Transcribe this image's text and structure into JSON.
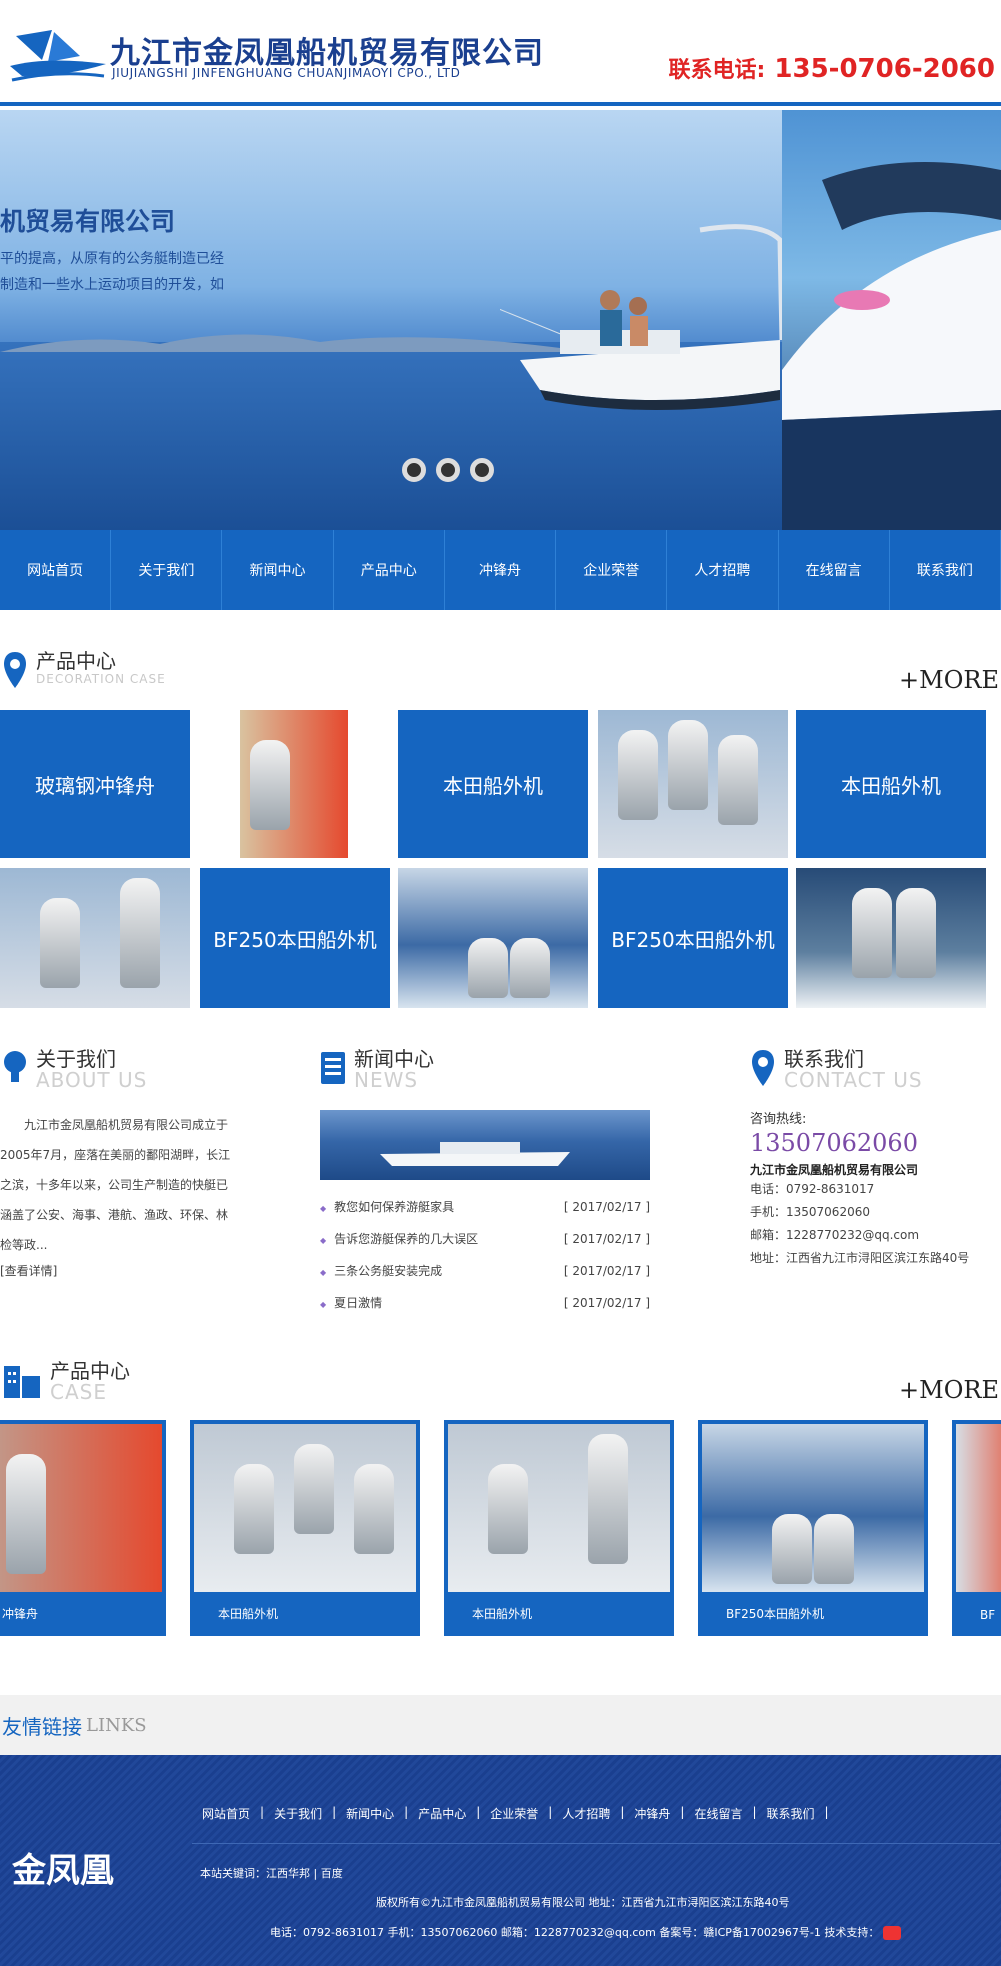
{
  "header": {
    "company_cn": "九江市金凤凰船机贸易有限公司",
    "company_en": "JIUJIANGSHI JINFENGHUANG CHUANJIMAOYI CPO., LTD",
    "phone_label": "联系电话:",
    "phone_number": "135-0706-2060"
  },
  "banner": {
    "title": "机贸易有限公司",
    "line1": "平的提高，从原有的公务艇制造已经",
    "line2": "制造和一些水上运动项目的开发，如"
  },
  "nav": [
    "网站首页",
    "关于我们",
    "新闻中心",
    "产品中心",
    "冲锋舟",
    "企业荣誉",
    "人才招聘",
    "在线留言",
    "联系我们"
  ],
  "products": {
    "title_cn": "产品中心",
    "title_en": "DECORATION  CASE",
    "more": "+MORE",
    "row1_labels": [
      "玻璃钢冲锋舟",
      "本田船外机",
      "本田船外机"
    ],
    "row2_labels": [
      "BF250本田船外机",
      "BF250本田船外机"
    ]
  },
  "about": {
    "title_cn": "关于我们",
    "title_en": "ABOUT US",
    "text": "九江市金凤凰船机贸易有限公司成立于2005年7月，座落在美丽的鄱阳湖畔，长江之滨，十多年以来，公司生产制造的快艇已涵盖了公安、海事、港航、渔政、环保、林检等政...",
    "more": "[查看详情]"
  },
  "news": {
    "title_cn": "新闻中心",
    "title_en": "NEWS",
    "items": [
      {
        "title": "教您如何保养游艇家具",
        "date": "[ 2017/02/17 ]"
      },
      {
        "title": "告诉您游艇保养的几大误区",
        "date": "[ 2017/02/17 ]"
      },
      {
        "title": "三条公务艇安装完成",
        "date": "[ 2017/02/17 ]"
      },
      {
        "title": "夏日激情",
        "date": "[ 2017/02/17 ]"
      }
    ]
  },
  "contact": {
    "title_cn": "联系我们",
    "title_en": "CONTACT US",
    "hotline_label": "咨询热线:",
    "hotline": "13507062060",
    "company": "九江市金凤凰船机贸易有限公司",
    "phone": "电话：0792-8631017",
    "mobile": "手机：13507062060",
    "email": "邮箱：1228770232@qq.com",
    "address": "地址：江西省九江市浔阳区滨江东路40号"
  },
  "cases": {
    "title_cn": "产品中心",
    "title_en": "CASE",
    "more": "+MORE",
    "labels": [
      "冲锋舟",
      "本田船外机",
      "本田船外机",
      "BF250本田船外机",
      "BF"
    ]
  },
  "links": {
    "cn": "友情链接",
    "en": "LINKS"
  },
  "footer": {
    "brand": "金凤凰",
    "nav": [
      "网站首页",
      "关于我们",
      "新闻中心",
      "产品中心",
      "企业荣誉",
      "人才招聘",
      "冲锋舟",
      "在线留言",
      "联系我们"
    ],
    "keywords": "本站关键词：江西华邦 |   百度",
    "copyright": "版权所有©九江市金凤凰船机贸易有限公司 地址：江西省九江市浔阳区滨江东路40号",
    "contact": "电话：0792-8631017 手机：13507062060 邮箱：1228770232@qq.com 备案号：赣ICP备17002967号-1 技术支持："
  },
  "colors": {
    "brand_blue": "#1565c0",
    "phone_red": "#e02424",
    "hotline_purple": "#7a4aa6"
  }
}
